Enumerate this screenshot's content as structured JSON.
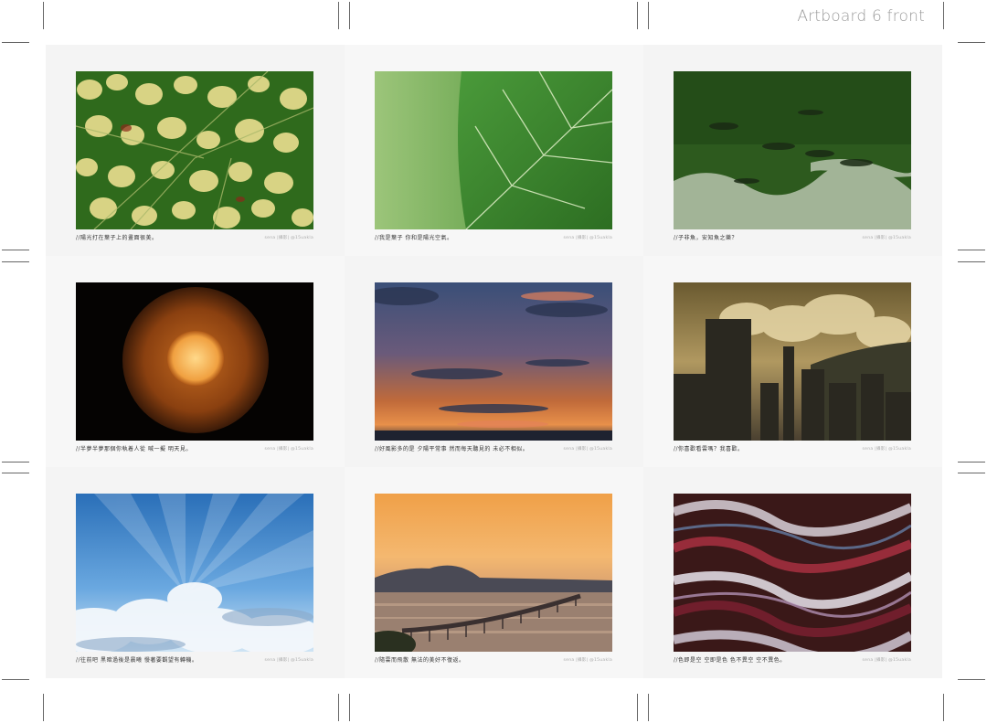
{
  "artboard": {
    "title": "Artboard 6 front"
  },
  "cards": [
    {
      "caption": "//陽光打在葉子上的畫面很美。",
      "credit": "sena |攝影| @15uakla"
    },
    {
      "caption": "//我是葉子 你和是陽光空氣。",
      "credit": "sena |攝影| @15uakla"
    },
    {
      "caption": "//子非魚，安知魚之樂？",
      "credit": "sena |攝影| @15uakla"
    },
    {
      "caption": "//半夢半夢那個你執着人從 喊一擬 明天見。",
      "credit": "sena |攝影| @15uakla"
    },
    {
      "caption": "//好風影多的是 夕陽平常事 然而每天聽見的 未必不相似。",
      "credit": "sena |攝影| @15uakla"
    },
    {
      "caption": "//你喜歡看雲嗎？我喜歡。",
      "credit": "sena |攝影| @15uakla"
    },
    {
      "caption": "//往前吧 黑暗過後是晨曦 慢著要觀望有轉機。",
      "credit": "sena |攝影| @15uakla"
    },
    {
      "caption": "//隨雲而飛散 無法的美好不復返。",
      "credit": "sena |攝影| @15uakla"
    },
    {
      "caption": "//色即是空 空即是色 色不異空 空不異色。",
      "credit": "sena |攝影| @15uakla"
    }
  ]
}
